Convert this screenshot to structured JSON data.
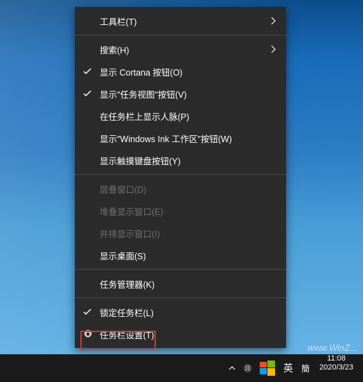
{
  "menu": {
    "toolbars": "工具栏(T)",
    "search": "搜索(H)",
    "show_cortana": "显示 Cortana 按钮(O)",
    "show_task_view": "显示\"任务视图\"按钮(V)",
    "show_people": "在任务栏上显示人脉(P)",
    "show_ink": "显示\"Windows Ink 工作区\"按钮(W)",
    "show_touch_keyboard": "显示触摸键盘按钮(Y)",
    "cascade": "层叠窗口(D)",
    "stacked": "堆叠显示窗口(E)",
    "side_by_side": "并排显示窗口(I)",
    "show_desktop": "显示桌面(S)",
    "task_manager": "任务管理器(K)",
    "lock_taskbar": "锁定任务栏(L)",
    "taskbar_settings": "任务栏设置(T)"
  },
  "taskbar": {
    "lang": "英",
    "ime": "簡",
    "time": "11:08",
    "date": "2020/3/23"
  },
  "watermark": "www.WinZ..."
}
